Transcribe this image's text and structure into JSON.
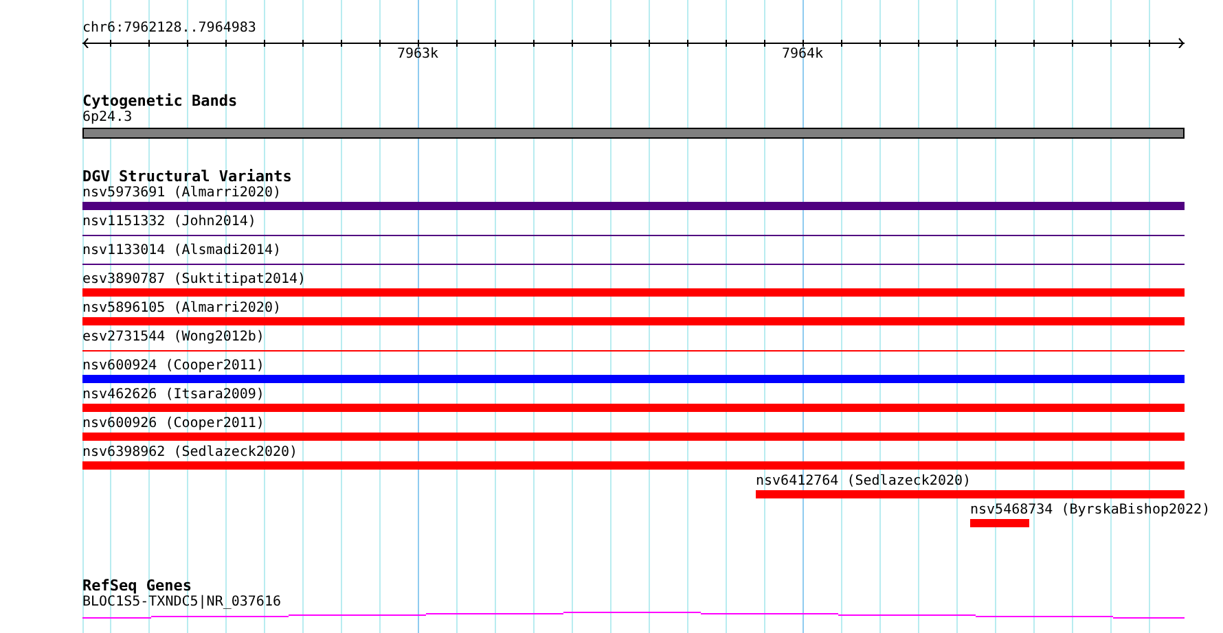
{
  "ruler": {
    "range_label": "chr6:7962128..7964983",
    "tick_labels": [
      "7963k",
      "7964k"
    ]
  },
  "cytogenetic_bands": {
    "title": "Cytogenetic Bands",
    "band_label": "6p24.3"
  },
  "dgv_structural_variants": {
    "title": "DGV Structural Variants",
    "features": [
      {
        "label": "nsv5973691 (Almarri2020)",
        "kind": "thick",
        "color": "#500080"
      },
      {
        "label": "nsv1151332 (John2014)",
        "kind": "thin",
        "color": "#500080"
      },
      {
        "label": "nsv1133014 (Alsmadi2014)",
        "kind": "thin",
        "color": "#500080"
      },
      {
        "label": "esv3890787 (Suktitipat2014)",
        "kind": "thick",
        "color": "#ff0000"
      },
      {
        "label": "nsv5896105 (Almarri2020)",
        "kind": "thick",
        "color": "#ff0000"
      },
      {
        "label": "esv2731544 (Wong2012b)",
        "kind": "thin",
        "color": "#ff0000"
      },
      {
        "label": "nsv600924 (Cooper2011)",
        "kind": "thick",
        "color": "#0000ff"
      },
      {
        "label": "nsv462626 (Itsara2009)",
        "kind": "thick",
        "color": "#ff0000"
      },
      {
        "label": "nsv600926 (Cooper2011)",
        "kind": "thick",
        "color": "#ff0000"
      },
      {
        "label": "nsv6398962 (Sedlazeck2020)",
        "kind": "thick",
        "color": "#ff0000"
      },
      {
        "label": "nsv6412764 (Sedlazeck2020)",
        "kind": "thick",
        "color": "#ff0000"
      },
      {
        "label": "nsv5468734 (ByrskaBishop2022)",
        "kind": "thick",
        "color": "#ff0000"
      }
    ]
  },
  "refseq_genes": {
    "title": "RefSeq Genes",
    "gene_label": "BLOC1S5-TXNDC5|NR_037616"
  }
}
